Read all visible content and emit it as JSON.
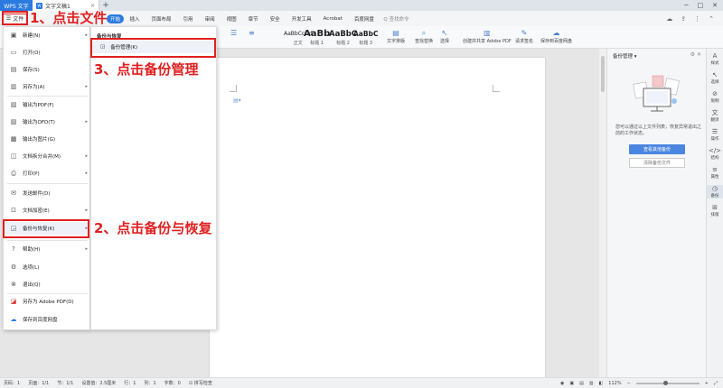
{
  "titlebar": {
    "app_tab": "WPS 文字",
    "doc_tab": "文字文稿1",
    "doc_icon": "W",
    "close": "×",
    "new_tab": "+"
  },
  "menubar": {
    "file_label": "文件",
    "tabs": [
      "开始",
      "插入",
      "页面布局",
      "引用",
      "审阅",
      "视图",
      "章节",
      "安全",
      "开发工具",
      "Acrobat",
      "百度网盘"
    ],
    "search": "Q 查找命令"
  },
  "ribbon": {
    "styles": [
      {
        "sample": "AaBbCcDd",
        "label": "正文"
      },
      {
        "sample": "AaBb",
        "label": "标题 1"
      },
      {
        "sample": "AaBbC",
        "label": "标题 2"
      },
      {
        "sample": "AaBbC",
        "label": "标题 3"
      }
    ],
    "buttons": [
      "文字排版",
      "查找替换",
      "选择",
      "创建并共享 Adobe PDF",
      "请求签名",
      "保存到百度网盘"
    ]
  },
  "file_menu": {
    "items": [
      {
        "label": "新建(N)",
        "icon": "new-doc-icon",
        "glyph": "▣",
        "arrow": true
      },
      {
        "label": "打开(O)",
        "icon": "folder-icon",
        "glyph": "▭",
        "arrow": false
      },
      {
        "label": "保存(S)",
        "icon": "save-icon",
        "glyph": "▤",
        "arrow": false
      },
      {
        "label": "另存为(A)",
        "icon": "save-as-icon",
        "glyph": "▥",
        "arrow": true
      },
      {
        "label": "输出为PDF(F)",
        "icon": "pdf-icon",
        "glyph": "▧",
        "arrow": false
      },
      {
        "label": "输出为OFD(T)",
        "icon": "ofd-icon",
        "glyph": "▨",
        "arrow": true
      },
      {
        "label": "输出为图片(G)",
        "icon": "image-icon",
        "glyph": "▩",
        "arrow": false
      },
      {
        "label": "文档拆分合并(M)",
        "icon": "split-merge-icon",
        "glyph": "◫",
        "arrow": true
      },
      {
        "label": "打印(P)",
        "icon": "print-icon",
        "glyph": "⎙",
        "arrow": true
      },
      {
        "label": "发送邮件(D)",
        "icon": "mail-icon",
        "glyph": "✉",
        "arrow": false
      },
      {
        "label": "文档加密(E)",
        "icon": "lock-icon",
        "glyph": "⊡",
        "arrow": true
      },
      {
        "label": "备份与恢复(K)",
        "icon": "backup-icon",
        "glyph": "◲",
        "arrow": true
      },
      {
        "label": "帮助(H)",
        "icon": "help-icon",
        "glyph": "?",
        "arrow": true
      },
      {
        "label": "选项(L)",
        "icon": "options-icon",
        "glyph": "⚙",
        "arrow": false
      },
      {
        "label": "退出(Q)",
        "icon": "exit-icon",
        "glyph": "⊗",
        "arrow": false
      },
      {
        "label": "另存为 Adobe PDF(D)",
        "icon": "adobe-pdf-icon",
        "glyph": "◪",
        "arrow": false
      },
      {
        "label": "保存到百度网盘",
        "icon": "cloud-icon",
        "glyph": "☁",
        "arrow": false
      }
    ]
  },
  "submenu": {
    "title": "备份与恢复",
    "item": "备份管理(K)"
  },
  "annotations": {
    "step1": "1、点击文件",
    "step2": "2、点击备份与恢复",
    "step3": "3、点击备份管理"
  },
  "right_panel": {
    "title": "备份管理 ▾",
    "description": "您可以通过以上文件列表，恢复异常退出之前的工作状态。",
    "btn_view": "查看其他备份",
    "btn_clear": "清除备份文件"
  },
  "right_bar": [
    {
      "label": "样式",
      "glyph": "A"
    },
    {
      "label": "选择",
      "glyph": "↖"
    },
    {
      "label": "限制",
      "glyph": "⊘"
    },
    {
      "label": "翻译",
      "glyph": "文"
    },
    {
      "label": "操作",
      "glyph": "☰"
    },
    {
      "label": "结构",
      "glyph": "</>"
    },
    {
      "label": "属性",
      "glyph": "≡"
    },
    {
      "label": "备份",
      "glyph": "◷"
    },
    {
      "label": "排版",
      "glyph": "⊞"
    }
  ],
  "statusbar": {
    "page_num": "页码：1",
    "page": "页面：1/1",
    "section": "节：1/1",
    "setting": "设置值：2.5厘米",
    "row": "行：1",
    "col": "列：1",
    "words": "字数：0",
    "spell": "拼写检查",
    "zoom": "112%"
  },
  "colors": {
    "accent": "#2b7ae0",
    "annotation": "#e02020"
  }
}
